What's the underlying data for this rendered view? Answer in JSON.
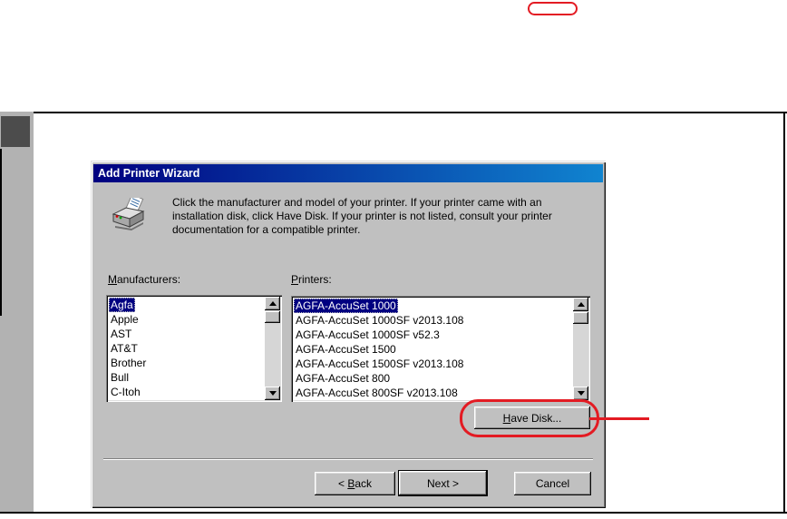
{
  "colors": {
    "annotation_red": "#e31b23",
    "title_gradient_start": "#000080",
    "title_gradient_end": "#1084d0",
    "dialog_bg": "#c0c0c0",
    "selection_bg": "#000080",
    "selection_fg": "#ffffff"
  },
  "dialog": {
    "title": "Add Printer Wizard",
    "instruction_lines": [
      "Click the manufacturer and model of your printer. If your printer came with an",
      "installation disk, click Have Disk. If your printer is not listed, consult your printer",
      "documentation for a compatible printer."
    ],
    "manufacturers": {
      "label": {
        "accel": "M",
        "post": "anufacturers:"
      },
      "selected_index": 0,
      "items": [
        "Agfa",
        "Apple",
        "AST",
        "AT&T",
        "Brother",
        "Bull",
        "C-Itoh"
      ]
    },
    "printers": {
      "label": {
        "accel": "P",
        "post": "rinters:"
      },
      "selected_index": 0,
      "items": [
        "AGFA-AccuSet 1000",
        "AGFA-AccuSet 1000SF v2013.108",
        "AGFA-AccuSet 1000SF v52.3",
        "AGFA-AccuSet 1500",
        "AGFA-AccuSet 1500SF v2013.108",
        "AGFA-AccuSet 800",
        "AGFA-AccuSet 800SF v2013.108"
      ]
    },
    "buttons": {
      "have_disk": {
        "accel": "H",
        "post": "ave Disk..."
      },
      "back": {
        "pre": "< ",
        "accel": "B",
        "post": "ack"
      },
      "next": {
        "label": "Next >"
      },
      "cancel": {
        "label": "Cancel"
      }
    }
  }
}
